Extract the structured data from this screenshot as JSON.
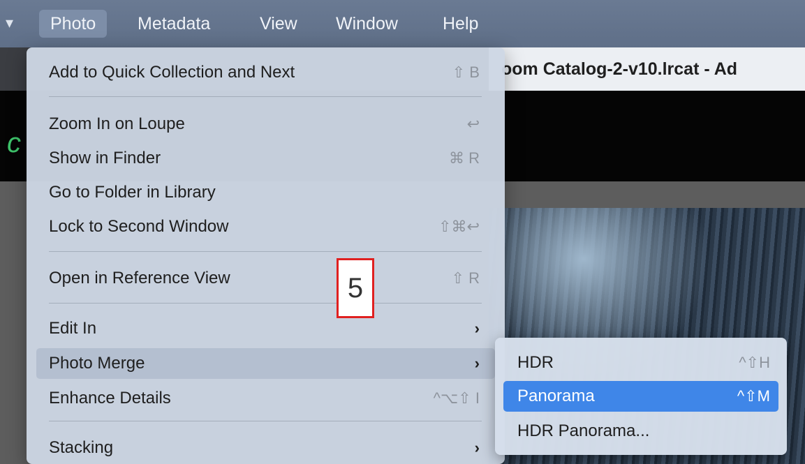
{
  "menubar": {
    "items": [
      {
        "label": "Photo",
        "active": true
      },
      {
        "label": "Metadata"
      },
      {
        "label": "View"
      },
      {
        "label": "Window"
      },
      {
        "label": "Help"
      }
    ],
    "bar_color": "#6a7a93"
  },
  "window": {
    "title": "oom Catalog-2-v10.lrcat - Ad"
  },
  "photo_menu": {
    "items": [
      {
        "label": "Add to Quick Collection and Next",
        "shortcut": "⇧ B"
      },
      {
        "label": "Zoom In on Loupe",
        "shortcut": "↩"
      },
      {
        "label": "Show in Finder",
        "shortcut": "⌘ R"
      },
      {
        "label": "Go to Folder in Library",
        "shortcut": ""
      },
      {
        "label": "Lock to Second Window",
        "shortcut": "⇧⌘↩"
      },
      {
        "label": "Open in Reference View",
        "shortcut": "⇧ R"
      },
      {
        "label": "Edit In",
        "submenu_indicator": "›"
      },
      {
        "label": "Photo Merge",
        "submenu_indicator": "›",
        "highlighted": true
      },
      {
        "label": "Enhance Details",
        "shortcut": "^⌥⇧ I"
      },
      {
        "label": "Stacking",
        "submenu_indicator": "›"
      }
    ]
  },
  "photo_merge_submenu": {
    "items": [
      {
        "label": "HDR",
        "shortcut": "^⇧H"
      },
      {
        "label": "Panorama",
        "shortcut": "^⇧M",
        "selected": true
      },
      {
        "label": "HDR Panorama...",
        "shortcut": ""
      }
    ],
    "selection_color": "#3f86e8"
  },
  "annotation": {
    "label": "5",
    "border_color": "#e02020"
  }
}
